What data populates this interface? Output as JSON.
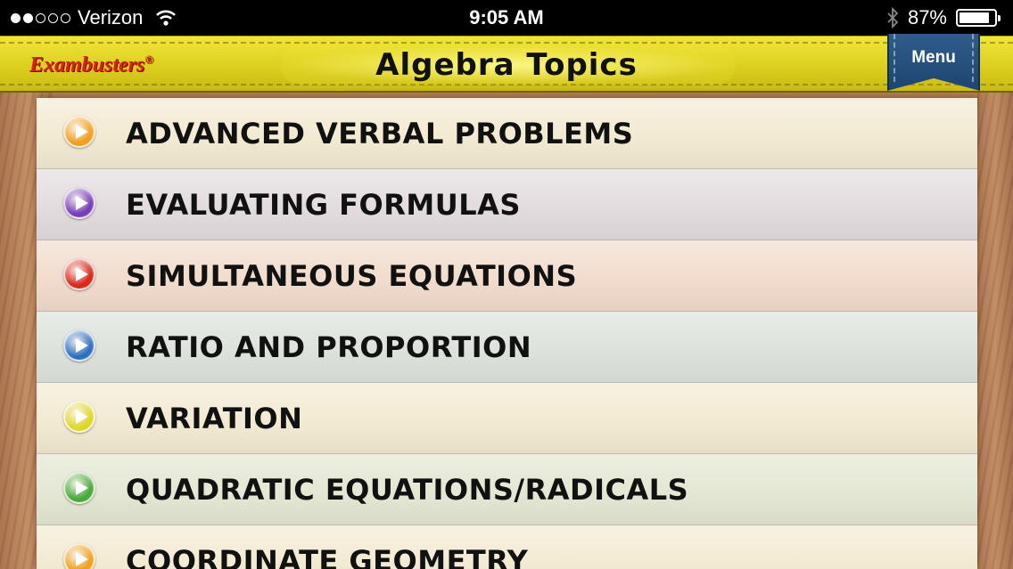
{
  "status_bar": {
    "carrier": "Verizon",
    "signal_bars_filled": 2,
    "signal_bars_total": 5,
    "time": "9:05 AM",
    "battery_percent": "87%",
    "battery_level": 0.87
  },
  "header": {
    "logo": "Exambusters",
    "logo_mark": "®",
    "title": "Algebra Topics",
    "menu_label": "Menu"
  },
  "topics": [
    {
      "label": "ADVANCED VERBAL PROBLEMS",
      "icon_color": "#f0a020",
      "row_color": "#f3ead3"
    },
    {
      "label": "EVALUATING FORMULAS",
      "icon_color": "#7a3db8",
      "row_color": "#e3dcdf"
    },
    {
      "label": "SIMULTANEOUS EQUATIONS",
      "icon_color": "#d8281c",
      "row_color": "#f1dccd"
    },
    {
      "label": "RATIO AND PROPORTION",
      "icon_color": "#2f6fc0",
      "row_color": "#dde2dc"
    },
    {
      "label": "VARIATION",
      "icon_color": "#e0d62a",
      "row_color": "#f3ead3"
    },
    {
      "label": "QUADRATIC EQUATIONS/RADICALS",
      "icon_color": "#4aa83a",
      "row_color": "#e4e7d3"
    },
    {
      "label": "COORDINATE GEOMETRY",
      "icon_color": "#f0a020",
      "row_color": "#f3ead3"
    }
  ]
}
